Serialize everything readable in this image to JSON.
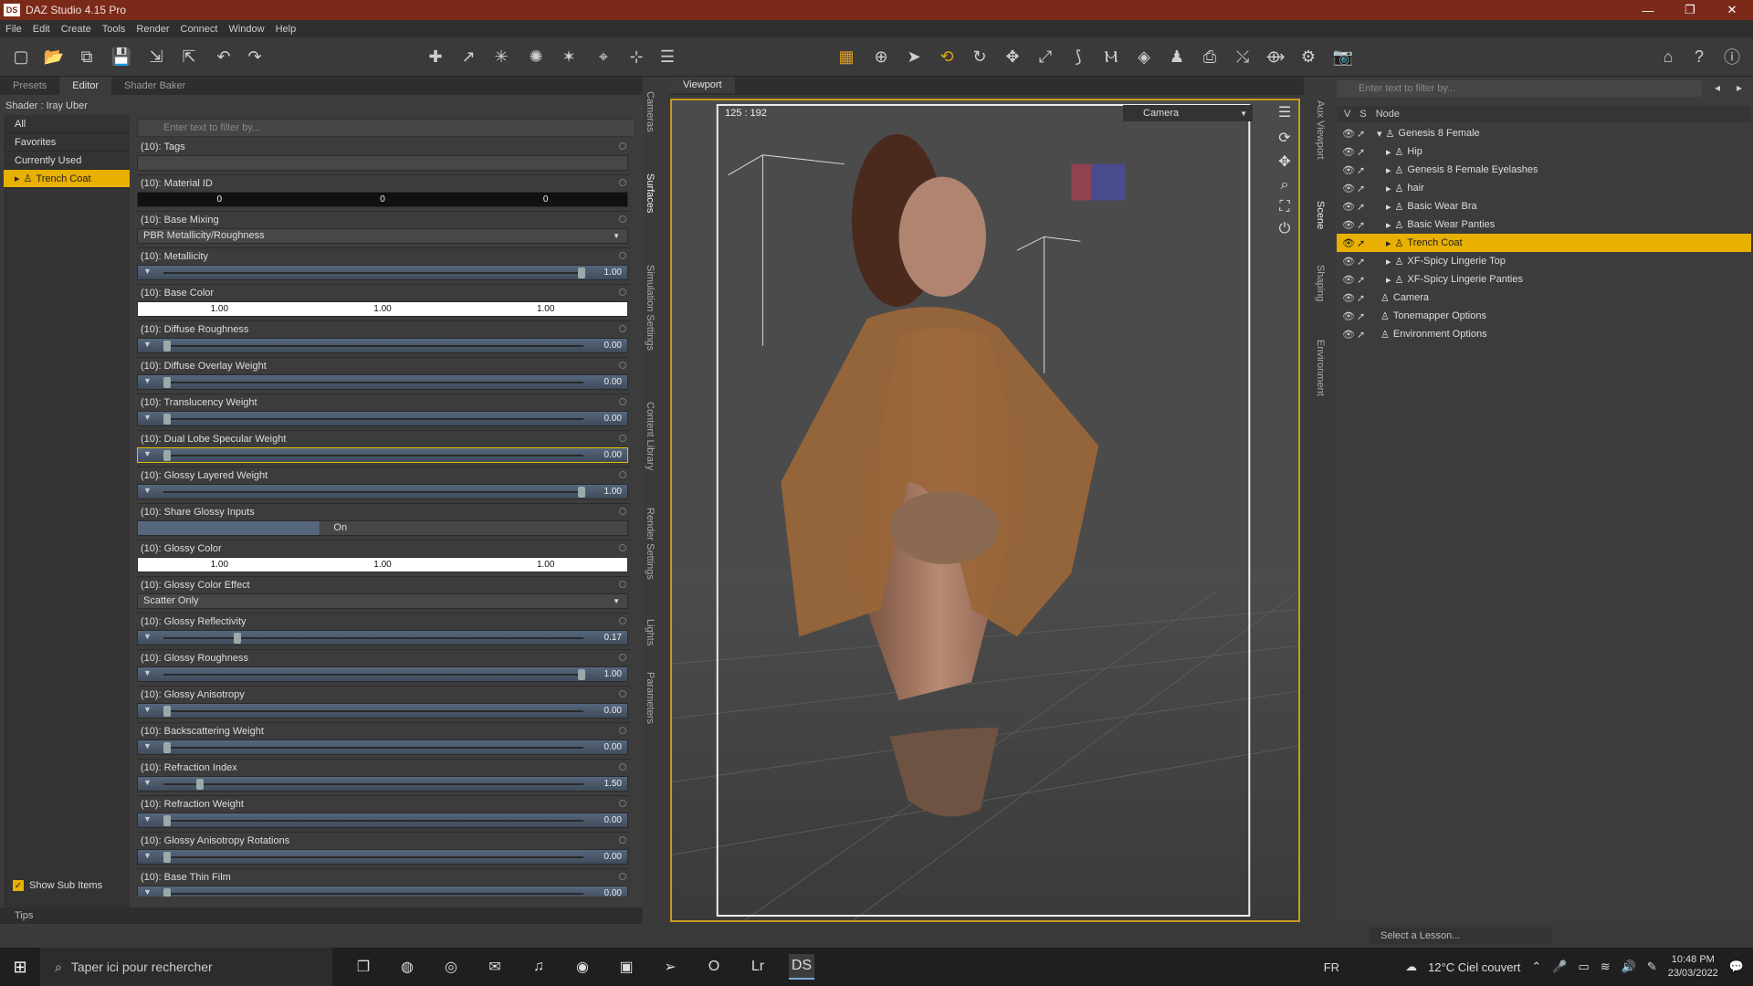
{
  "window": {
    "title": "DAZ Studio 4.15 Pro",
    "logo": "DS"
  },
  "menu": [
    "File",
    "Edit",
    "Create",
    "Tools",
    "Render",
    "Connect",
    "Window",
    "Help"
  ],
  "left_panel": {
    "tabs": [
      "Presets",
      "Editor",
      "Shader Baker"
    ],
    "active_tab": "Editor",
    "shader_label": "Shader : Iray Uber",
    "filter_placeholder": "Enter text to filter by...",
    "categories": [
      "All",
      "Favorites",
      "Currently Used",
      "Trench Coat"
    ],
    "show_sub_items": "Show Sub Items",
    "properties": [
      {
        "label": "(10): Tags",
        "type": "text",
        "values": []
      },
      {
        "label": "(10): Material ID",
        "type": "dark",
        "values": [
          "0",
          "0",
          "0"
        ]
      },
      {
        "label": "(10): Base Mixing",
        "type": "drop",
        "values": [
          "PBR Metallicity/Roughness"
        ]
      },
      {
        "label": "(10): Metallicity",
        "type": "slider",
        "values": [
          "1.00"
        ],
        "level": 1.0
      },
      {
        "label": "(10): Base Color",
        "type": "white",
        "values": [
          "1.00",
          "1.00",
          "1.00"
        ]
      },
      {
        "label": "(10): Diffuse Roughness",
        "type": "slider",
        "values": [
          "0.00"
        ],
        "level": 0.0
      },
      {
        "label": "(10): Diffuse Overlay Weight",
        "type": "slider",
        "values": [
          "0.00"
        ],
        "level": 0.0
      },
      {
        "label": "(10): Translucency Weight",
        "type": "slider",
        "values": [
          "0.00"
        ],
        "level": 0.0
      },
      {
        "label": "(10): Dual Lobe Specular Weight",
        "type": "slider",
        "values": [
          "0.00"
        ],
        "level": 0.0,
        "hl": true
      },
      {
        "label": "(10): Glossy Layered Weight",
        "type": "slider",
        "values": [
          "1.00"
        ],
        "level": 1.0
      },
      {
        "label": "(10): Share Glossy Inputs",
        "type": "toggle",
        "values": [
          "On"
        ]
      },
      {
        "label": "(10): Glossy Color",
        "type": "white",
        "values": [
          "1.00",
          "1.00",
          "1.00"
        ]
      },
      {
        "label": "(10): Glossy Color Effect",
        "type": "drop",
        "values": [
          "Scatter Only"
        ]
      },
      {
        "label": "(10): Glossy Reflectivity",
        "type": "slider",
        "values": [
          "0.17"
        ],
        "level": 0.17
      },
      {
        "label": "(10): Glossy Roughness",
        "type": "slider",
        "values": [
          "1.00"
        ],
        "level": 1.0
      },
      {
        "label": "(10): Glossy Anisotropy",
        "type": "slider",
        "values": [
          "0.00"
        ],
        "level": 0.0
      },
      {
        "label": "(10): Backscattering Weight",
        "type": "slider",
        "values": [
          "0.00"
        ],
        "level": 0.0
      },
      {
        "label": "(10): Refraction Index",
        "type": "slider",
        "values": [
          "1.50"
        ],
        "level": 0.08
      },
      {
        "label": "(10): Refraction Weight",
        "type": "slider",
        "values": [
          "0.00"
        ],
        "level": 0.0
      },
      {
        "label": "(10): Glossy Anisotropy Rotations",
        "type": "slider",
        "values": [
          "0.00"
        ],
        "level": 0.0
      },
      {
        "label": "(10): Base Thin Film",
        "type": "slider",
        "values": [
          "0.00"
        ],
        "level": 0.0
      }
    ],
    "tips": "Tips"
  },
  "side_tabs_left": [
    "Cameras",
    "Surfaces",
    "Simulation Settings",
    "Content Library",
    "Render Settings",
    "Lights",
    "Parameters"
  ],
  "viewport": {
    "title": "Viewport",
    "coords": "125 : 192",
    "camera": "Camera"
  },
  "right_panel": {
    "filter_placeholder": "Enter text to filter by...",
    "headers": [
      "V",
      "S",
      "Node"
    ],
    "nodes": [
      {
        "name": "Genesis 8 Female",
        "depth": 0
      },
      {
        "name": "Hip",
        "depth": 1
      },
      {
        "name": "Genesis 8 Female Eyelashes",
        "depth": 1
      },
      {
        "name": "hair",
        "depth": 1
      },
      {
        "name": "Basic Wear Bra",
        "depth": 1
      },
      {
        "name": "Basic Wear Panties",
        "depth": 1
      },
      {
        "name": "Trench Coat",
        "depth": 1,
        "active": true
      },
      {
        "name": "XF-Spicy Lingerie Top",
        "depth": 1
      },
      {
        "name": "XF-Spicy Lingerie Panties",
        "depth": 1
      },
      {
        "name": "Camera",
        "depth": 0
      },
      {
        "name": "Tonemapper Options",
        "depth": 0
      },
      {
        "name": "Environment Options",
        "depth": 0
      }
    ],
    "lesson": "Select a Lesson..."
  },
  "side_tabs_right": [
    "Aux Viewport",
    "Scene",
    "Shaping",
    "Environment"
  ],
  "taskbar": {
    "search": "Taper ici pour rechercher",
    "lang": "FR",
    "weather": "12°C Ciel couvert",
    "time": "10:48 PM",
    "date": "23/03/2022"
  },
  "colors": {
    "accent": "#e8b000",
    "title": "#7b2a1a"
  }
}
